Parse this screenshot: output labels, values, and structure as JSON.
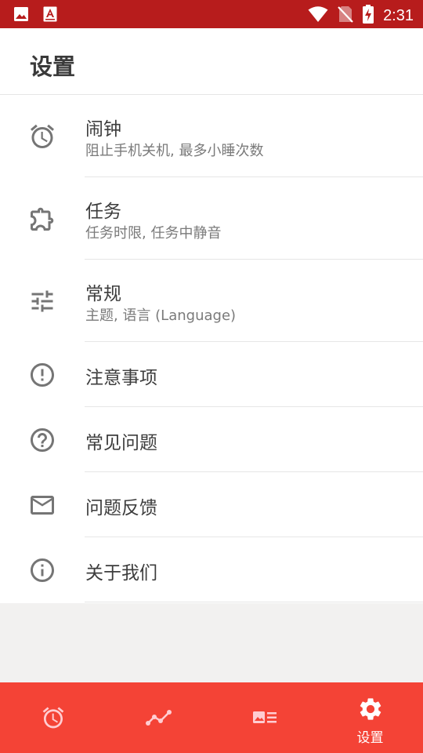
{
  "status_bar": {
    "time": "2:31",
    "icons": [
      "gallery-icon",
      "pdf-app-icon",
      "wifi-icon",
      "no-sim-icon",
      "battery-charging-icon"
    ]
  },
  "page": {
    "title": "设置"
  },
  "settings": {
    "items": [
      {
        "label": "闹钟",
        "sublabel": "阻止手机关机, 最多小睡次数",
        "icon": "alarm-clock-icon"
      },
      {
        "label": "任务",
        "sublabel": "任务时限, 任务中静音",
        "icon": "puzzle-icon"
      },
      {
        "label": "常规",
        "sublabel": "主题, 语言 (Language)",
        "icon": "tune-sliders-icon"
      },
      {
        "label": "注意事项",
        "icon": "alert-circle-icon"
      },
      {
        "label": "常见问题",
        "icon": "help-circle-icon"
      },
      {
        "label": "问题反馈",
        "icon": "mail-icon"
      },
      {
        "label": "关于我们",
        "icon": "info-circle-icon"
      }
    ]
  },
  "bottom_nav": {
    "tabs": [
      {
        "icon": "alarm-clock-icon",
        "active": false
      },
      {
        "icon": "trend-line-icon",
        "active": false
      },
      {
        "icon": "image-list-icon",
        "active": false
      },
      {
        "icon": "gear-icon",
        "label": "设置",
        "active": true
      }
    ]
  },
  "colors": {
    "status_bar": "#b71c1c",
    "bottom_nav": "#f44336",
    "background": "#f2f1f0",
    "icon_gray": "#757575",
    "nav_inactive": "#ffcdd2"
  }
}
